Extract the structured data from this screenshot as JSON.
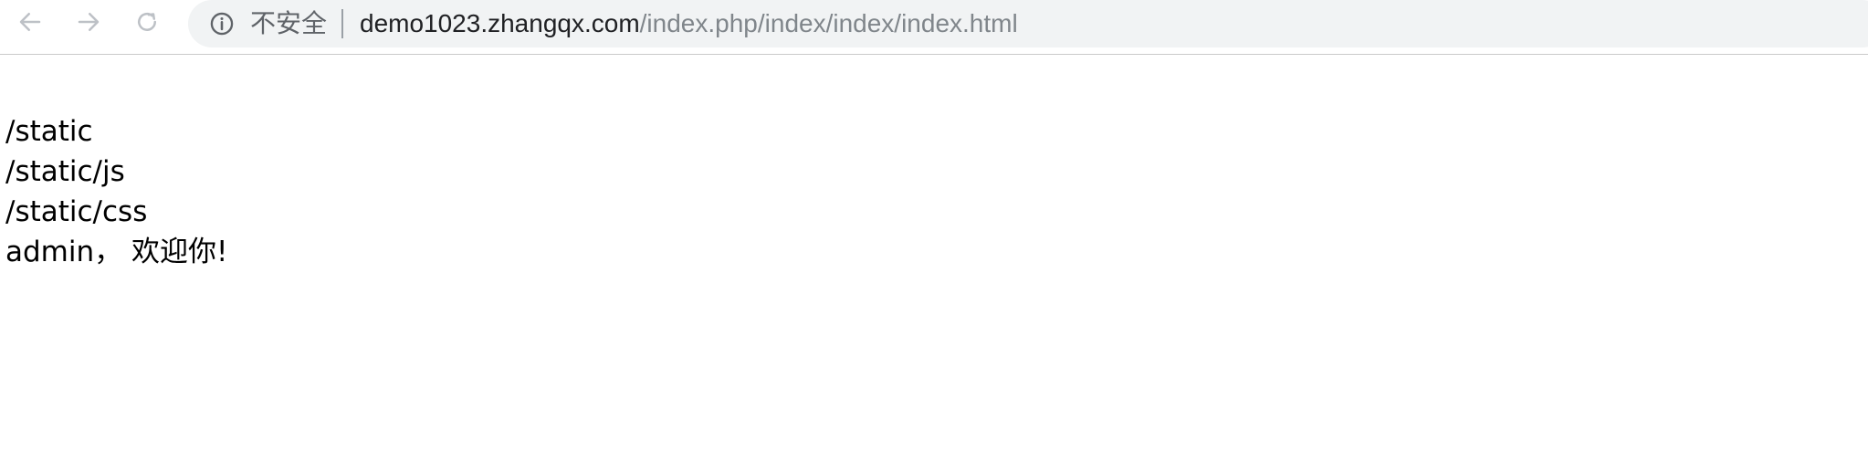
{
  "browser": {
    "back_icon": "arrow-left-icon",
    "forward_icon": "arrow-right-icon",
    "reload_icon": "reload-icon",
    "info_icon": "info-circle-icon",
    "security_label": "不安全",
    "url_host": "demo1023.zhangqx.com",
    "url_path": "/index.php/index/index/index.html"
  },
  "page": {
    "lines": [
      "/static",
      "/static/js",
      "/static/css",
      "admin， 欢迎你!"
    ]
  }
}
